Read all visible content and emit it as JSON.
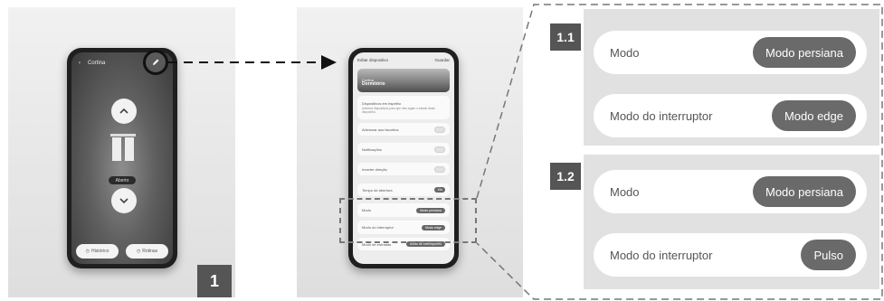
{
  "phone1": {
    "back_glyph": "‹",
    "title": "Cortina",
    "state_label": "Aberto",
    "history_button": "Histórico",
    "routines_button": "Rotinas"
  },
  "step_badge": "1",
  "phone2": {
    "header_title": "Editar dispositivo",
    "header_action": "Guardar",
    "photo_caption_small": "Cortina",
    "photo_caption_main": "Dormitório",
    "mirror_title": "Dispositivos em espelho",
    "mirror_desc": "Adicione dispositivos para que eles sigam o estado deste dispositivo.",
    "favorites": "Adicionar aos favoritos",
    "notifications": "Notificações",
    "invert": "Inverter direção",
    "opening_time": "Tempo de abertura",
    "opening_value": "15s",
    "mode_label": "Modo",
    "mode_value": "Modo persiana",
    "switch_mode_label": "Modo do interruptor",
    "switch_mode_value": "Modo edge",
    "input_mode_label": "Modo de entradas",
    "input_mode_value": "Modo de interruptores"
  },
  "sections": [
    {
      "badge": "1.1",
      "rows": [
        {
          "label": "Modo",
          "value": "Modo persiana"
        },
        {
          "label": "Modo do interruptor",
          "value": "Modo edge"
        }
      ]
    },
    {
      "badge": "1.2",
      "rows": [
        {
          "label": "Modo",
          "value": "Modo persiana"
        },
        {
          "label": "Modo do interruptor",
          "value": "Pulso"
        }
      ]
    }
  ],
  "icons": {
    "edit": "pencil-icon",
    "up": "chevron-up-icon",
    "down": "chevron-down-icon",
    "history": "clock-icon",
    "routines": "clock-icon"
  },
  "colors": {
    "badge": "#555555",
    "pill": "#6a6a6a",
    "section_bg": "#e1e1e1"
  }
}
